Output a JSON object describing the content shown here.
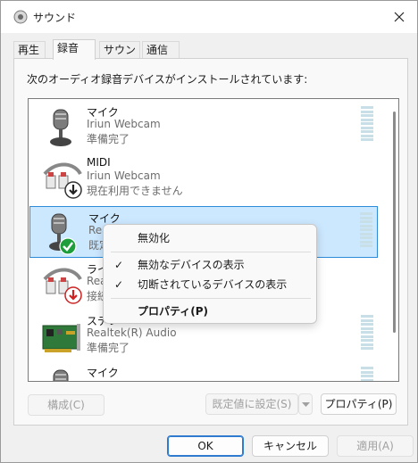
{
  "window": {
    "title": "サウンド",
    "icon": "speaker-icon",
    "close_icon": "close-icon"
  },
  "tabs": [
    {
      "label": "再生",
      "active": false
    },
    {
      "label": "録音",
      "active": true
    },
    {
      "label": "サウンド",
      "active": false
    },
    {
      "label": "通信",
      "active": false
    }
  ],
  "description": "次のオーディオ録音デバイスがインストールされています:",
  "devices": [
    {
      "name": "マイク",
      "driver": "Iriun Webcam",
      "status": "準備完了",
      "icon": "microphone-icon",
      "badge": "",
      "selected": false
    },
    {
      "name": "MIDI",
      "driver": "Iriun Webcam",
      "status": "現在利用できません",
      "icon": "rca-cable-icon",
      "badge": "down-arrow-badge-icon",
      "selected": false
    },
    {
      "name": "マイク",
      "driver": "Real",
      "status": "既定",
      "icon": "microphone-icon",
      "badge": "green-check-badge-icon",
      "selected": true
    },
    {
      "name": "ライン",
      "driver": "Real",
      "status": "接続",
      "icon": "rca-cable-icon",
      "badge": "red-down-arrow-badge-icon",
      "selected": false
    },
    {
      "name": "ステレ",
      "driver": "Realtek(R) Audio",
      "status": "準備完了",
      "icon": "sound-card-icon",
      "badge": "",
      "selected": false
    },
    {
      "name": "マイク",
      "driver": "",
      "status": "",
      "icon": "microphone-icon",
      "badge": "",
      "selected": false
    }
  ],
  "context_menu": {
    "items": [
      {
        "label": "無効化",
        "checked": false,
        "bold": false
      },
      {
        "label": "無効なデバイスの表示",
        "checked": true,
        "bold": false
      },
      {
        "label": "切断されているデバイスの表示",
        "checked": true,
        "bold": false
      },
      {
        "label": "プロパティ(P)",
        "checked": false,
        "bold": true
      }
    ],
    "check_glyph": "✓"
  },
  "buttons": {
    "configure": "構成(C)",
    "set_default": "既定値に設定(S)",
    "properties": "プロパティ(P)",
    "ok": "OK",
    "cancel": "キャンセル",
    "apply": "適用(A)"
  },
  "colors": {
    "selection_bg": "#cce8ff",
    "selection_border": "#2e8bd8",
    "accent": "#2e7bd0"
  }
}
